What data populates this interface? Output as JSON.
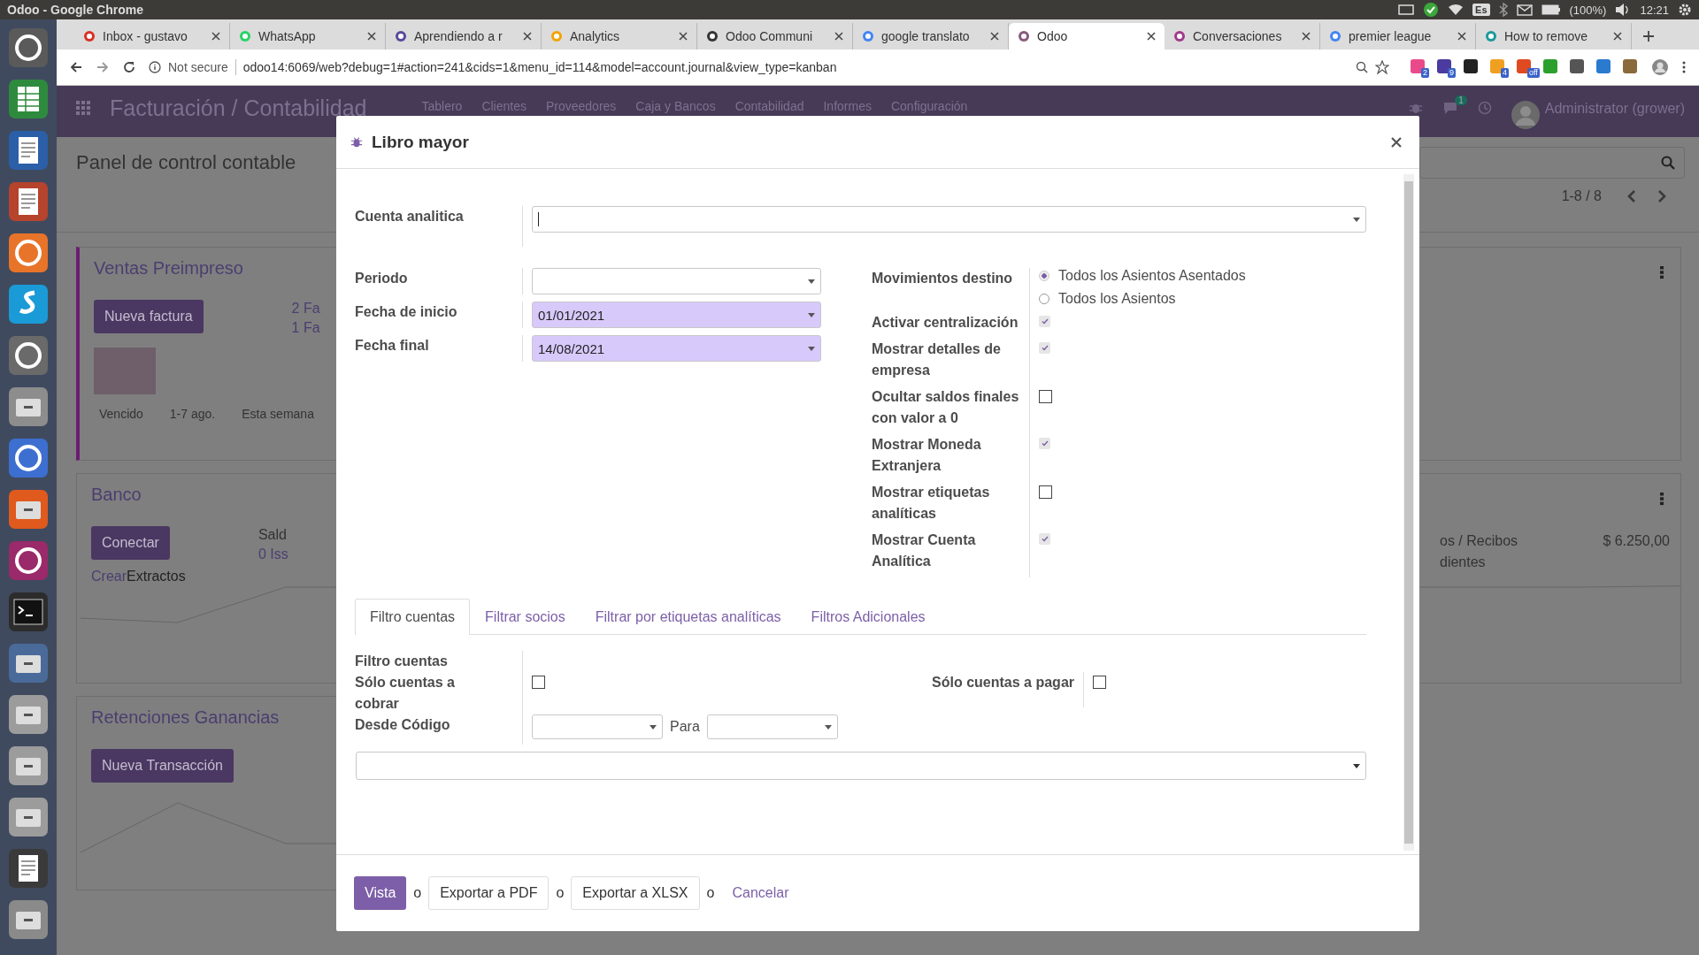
{
  "system_bar": {
    "title": "Odoo - Google Chrome",
    "keyboard": "Es",
    "battery": "(100%)",
    "time": "12:21"
  },
  "browser": {
    "tabs": [
      {
        "title": "Inbox - gustavo",
        "selected": false
      },
      {
        "title": "WhatsApp",
        "selected": false
      },
      {
        "title": "Aprendiendo a r",
        "selected": false
      },
      {
        "title": "Analytics",
        "selected": false
      },
      {
        "title": "Odoo Communi",
        "selected": false
      },
      {
        "title": "google translato",
        "selected": false
      },
      {
        "title": "Odoo",
        "selected": true
      },
      {
        "title": "Conversaciones",
        "selected": false
      },
      {
        "title": "premier league",
        "selected": false
      },
      {
        "title": "How to remove",
        "selected": false
      }
    ],
    "security": "Not secure",
    "url": "odoo14:6069/web?debug=1#action=241&cids=1&menu_id=114&model=account.journal&view_type=kanban",
    "extensions": [
      {
        "kind": "badged",
        "badge": "2"
      },
      {
        "kind": "badged",
        "badge": "9"
      },
      {
        "kind": "plain"
      },
      {
        "kind": "badged",
        "badge": "4"
      },
      {
        "kind": "badged",
        "badge": "off"
      },
      {
        "kind": "plain"
      },
      {
        "kind": "plain"
      },
      {
        "kind": "plain"
      },
      {
        "kind": "plain"
      }
    ]
  },
  "navbar": {
    "app_title": "Facturación / Contabilidad",
    "menu": [
      "Tablero",
      "Clientes",
      "Proveedores",
      "Caja y Bancos",
      "Contabilidad",
      "Informes",
      "Configuración"
    ],
    "chat_count": "1",
    "user": "Administrator (grower)"
  },
  "dashboard": {
    "title": "Panel de control contable",
    "pager": "1-8 / 8",
    "cards": [
      {
        "kind": "full",
        "title": "Ventas Preimpreso",
        "color": "#6b1d72",
        "button": "Nueva factura",
        "lines": [
          "2 Fa",
          "1 Fa"
        ],
        "bar_labels": [
          "Vencido",
          "1-7 ago.",
          "Esta semana"
        ]
      },
      {
        "kind": "full",
        "title": "Banco",
        "button": "Conectar",
        "link": "Crear",
        "link_suffix": "Extractos",
        "lines": [
          "Sald",
          "0 Iss"
        ],
        "right_lines": [
          "os / Recibos",
          "dientes"
        ],
        "amount": "$ 6.250,00"
      },
      {
        "kind": "half",
        "title": "Retenciones Ganancias",
        "button": "Nueva Transacción"
      }
    ]
  },
  "dialog": {
    "title": "Libro mayor",
    "analytic_account": {
      "label": "Cuenta analitica",
      "required": false
    },
    "period": {
      "label": "Periodo",
      "required": false
    },
    "date_from": {
      "label": "Fecha de inicio",
      "value": "01/01/2021",
      "required": true
    },
    "date_to": {
      "label": "Fecha final",
      "value": "14/08/2021",
      "required": true
    },
    "target_moves": {
      "label": "Movimientos destino",
      "options": [
        {
          "label": "Todos los Asientos Asentados",
          "selected": true
        },
        {
          "label": "Todos los Asientos",
          "selected": false
        }
      ]
    },
    "options": [
      {
        "label": "Activar centralización",
        "checked": true
      },
      {
        "label": "Mostrar detalles de empresa",
        "checked": true
      },
      {
        "label": "Ocultar saldos finales con valor a 0",
        "checked": false
      },
      {
        "label": "Mostrar Moneda Extranjera",
        "checked": true
      },
      {
        "label": "Mostrar etiquetas analíticas",
        "checked": false
      },
      {
        "label": "Mostrar Cuenta Analítica",
        "checked": true
      }
    ],
    "tabs": [
      {
        "label": "Filtro cuentas",
        "selected": true
      },
      {
        "label": "Filtrar socios",
        "selected": false
      },
      {
        "label": "Filtrar por etiquetas analíticas",
        "selected": false
      },
      {
        "label": "Filtros Adicionales",
        "selected": false
      }
    ],
    "account_filter": {
      "heading": "Filtro cuentas",
      "receivable": {
        "label": "Sólo cuentas a cobrar",
        "checked": false
      },
      "payable": {
        "label": "Sólo cuentas a pagar",
        "checked": false
      },
      "code_from": {
        "label": "Desde Código"
      },
      "code_to": {
        "label": "Para"
      }
    },
    "buttons": [
      {
        "label": "Vista",
        "kind": "primary"
      },
      {
        "label": "Exportar a PDF",
        "kind": "secondary"
      },
      {
        "label": "Exportar a XLSX",
        "kind": "secondary"
      },
      {
        "label": "Cancelar",
        "kind": "link"
      }
    ],
    "separators": [
      "o",
      "o",
      "o"
    ]
  }
}
